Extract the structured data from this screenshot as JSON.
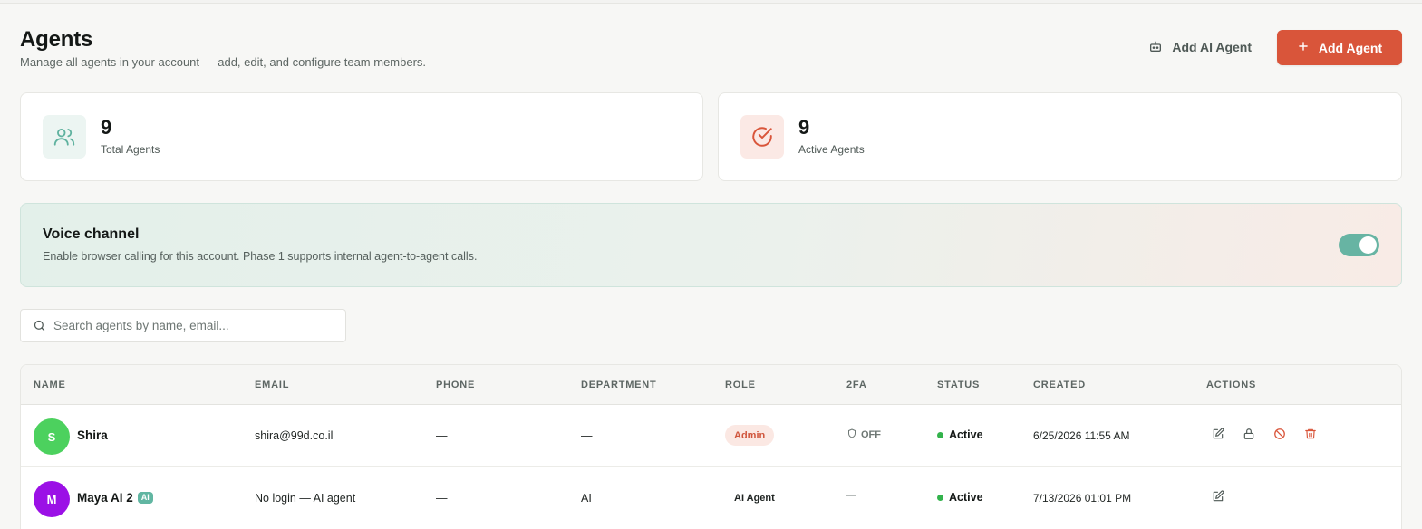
{
  "header": {
    "title": "Agents",
    "subtitle": "Manage all agents in your account — add, edit, and configure team members.",
    "add_ai_agent_label": "Add AI Agent",
    "add_agent_label": "Add Agent"
  },
  "stats": [
    {
      "value": "9",
      "label": "Total Agents",
      "icon": "users-icon"
    },
    {
      "value": "9",
      "label": "Active Agents",
      "icon": "check-circle-icon"
    }
  ],
  "voice_channel": {
    "title": "Voice channel",
    "description": "Enable browser calling for this account. Phase 1 supports internal agent-to-agent calls.",
    "enabled": true
  },
  "search": {
    "placeholder": "Search agents by name, email..."
  },
  "table": {
    "columns": [
      "NAME",
      "EMAIL",
      "PHONE",
      "DEPARTMENT",
      "ROLE",
      "2FA",
      "STATUS",
      "CREATED",
      "ACTIONS"
    ],
    "rows": [
      {
        "initial": "S",
        "avatar_color": "#4cd15e",
        "name": "Shira",
        "ai_badge": "",
        "email": "shira@99d.co.il",
        "phone": "—",
        "department": "—",
        "role": "Admin",
        "twofa": "OFF",
        "status": "Active",
        "created": "6/25/2026 11:55 AM"
      },
      {
        "initial": "M",
        "avatar_color": "#9b10e6",
        "name": "Maya AI 2",
        "ai_badge": "AI",
        "email": "No login — AI agent",
        "phone": "—",
        "department": "AI",
        "role": "AI Agent",
        "twofa": "—",
        "status": "Active",
        "created": "7/13/2026 01:01 PM"
      }
    ]
  },
  "colors": {
    "accent": "#d9553a",
    "teal": "#67b4a3",
    "active": "#33b34c"
  }
}
